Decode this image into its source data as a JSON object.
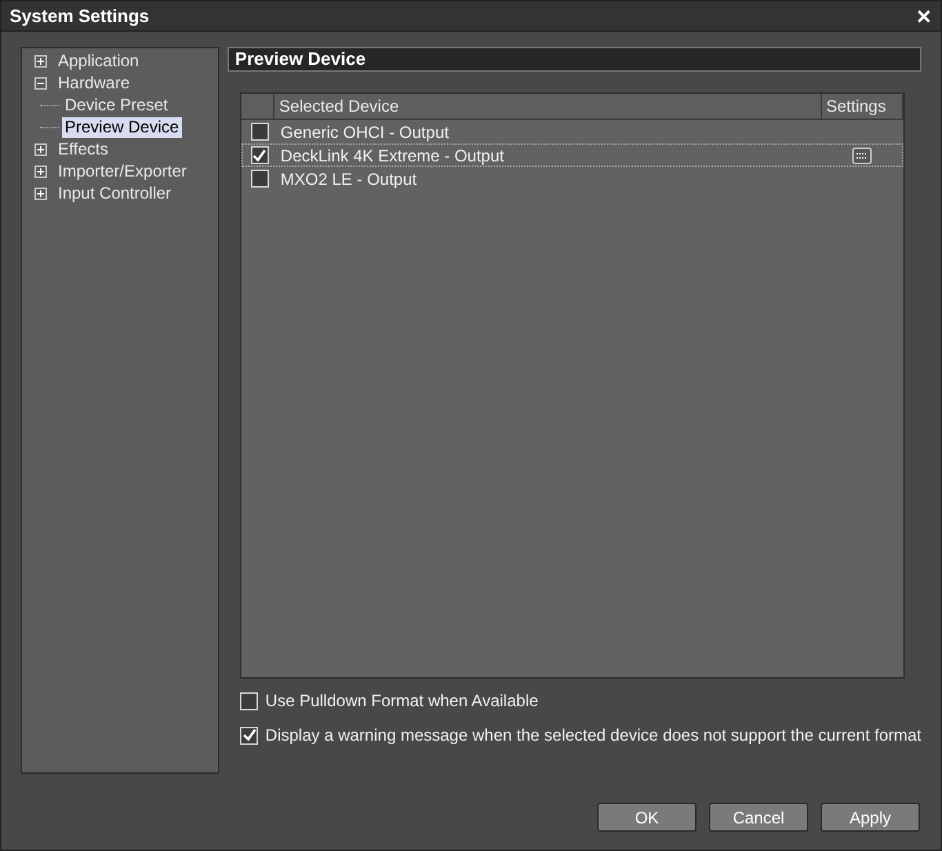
{
  "window": {
    "title": "System Settings",
    "close": "✕"
  },
  "tree": [
    {
      "label": "Application",
      "expanded": false,
      "selected": false
    },
    {
      "label": "Hardware",
      "expanded": true,
      "selected": false,
      "children": [
        {
          "label": "Device Preset",
          "selected": false
        },
        {
          "label": "Preview Device",
          "selected": true
        }
      ]
    },
    {
      "label": "Effects",
      "expanded": false,
      "selected": false
    },
    {
      "label": "Importer/Exporter",
      "expanded": false,
      "selected": false
    },
    {
      "label": "Input Controller",
      "expanded": false,
      "selected": false
    }
  ],
  "panel_title": "Preview Device",
  "table": {
    "columns": [
      "Selected Device",
      "Settings"
    ],
    "rows": [
      {
        "device": "Generic OHCI - Output",
        "checked": false,
        "focused": false,
        "settings_button": false
      },
      {
        "device": "DeckLink 4K Extreme - Output",
        "checked": true,
        "focused": true,
        "settings_button": true
      },
      {
        "device": "MXO2 LE - Output",
        "checked": false,
        "focused": false,
        "settings_button": false
      }
    ]
  },
  "options": [
    {
      "label": "Use Pulldown Format when Available",
      "checked": false
    },
    {
      "label": "Display a warning message when the selected device does not support the current format",
      "checked": true
    }
  ],
  "buttons": [
    "OK",
    "Cancel",
    "Apply"
  ]
}
